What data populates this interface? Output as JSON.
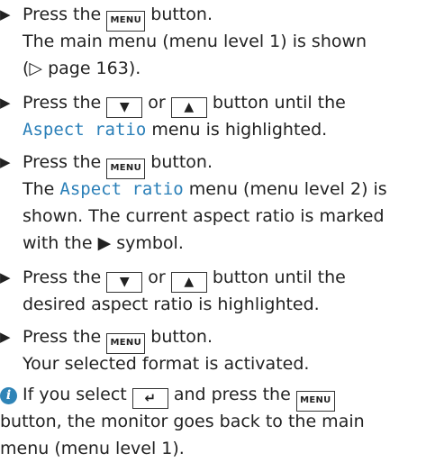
{
  "steps": [
    {
      "line1": {
        "pre": "Press the ",
        "key": "MENU",
        "post": " button."
      },
      "line2": "The main menu (menu level 1) is shown",
      "line3": "(▷ page 163)."
    },
    {
      "line1": {
        "pre": "Press the ",
        "key1": "▼",
        "mid": " or ",
        "key2": "▲",
        "post": " button until the"
      },
      "line2": {
        "highlight": "Aspect ratio",
        "post": " menu is highlighted."
      }
    },
    {
      "line1": {
        "pre": "Press the ",
        "key": "MENU",
        "post": " button."
      },
      "line2": {
        "pre": "The ",
        "highlight": "Aspect ratio",
        "post": " menu (menu level 2) is"
      },
      "line3": "shown. The current aspect ratio is marked",
      "line4": "with the ▶ symbol."
    },
    {
      "line1": {
        "pre": "Press the ",
        "key1": "▼",
        "mid": " or ",
        "key2": "▲",
        "post": " button until the"
      },
      "line2": "desired aspect ratio is highlighted."
    },
    {
      "line1": {
        "pre": "Press the ",
        "key": "MENU",
        "post": " button."
      },
      "line2": "Your selected format is activated."
    }
  ],
  "note": {
    "icon": "i",
    "line1": {
      "pre": "If you select ",
      "key1": "↵",
      "mid": " and press the ",
      "key2": "MENU"
    },
    "line2": "button, the monitor goes back to the main",
    "line3": "menu (menu level 1)."
  },
  "bullet_glyph": "▶"
}
